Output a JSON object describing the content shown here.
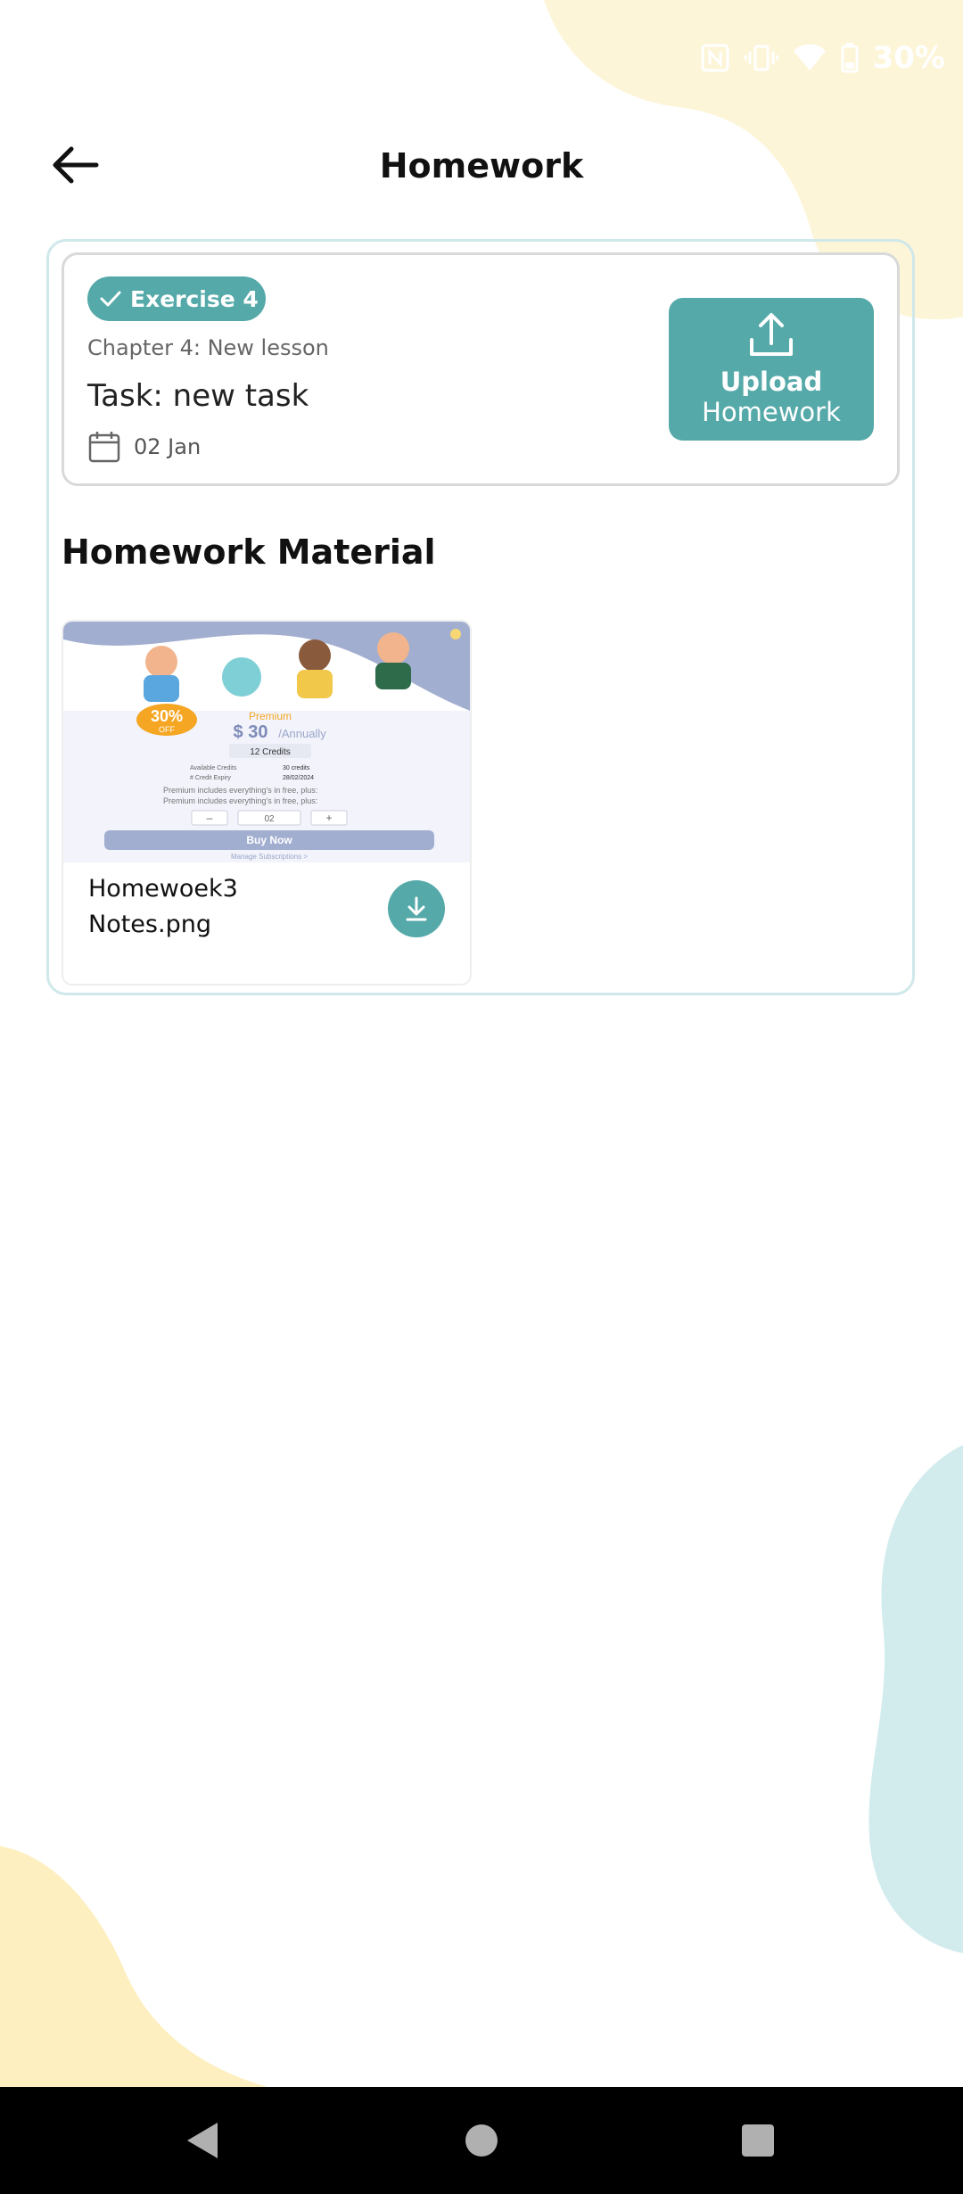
{
  "colors": {
    "accent": "#56a9a9",
    "background": "#ffffff",
    "yellow_blob": "#fdf5d8",
    "teal_blob": "#d2ecee"
  },
  "status_bar": {
    "battery": "30%",
    "icons": [
      "nfc-icon",
      "vibrate-icon",
      "wifi-icon",
      "battery-icon"
    ]
  },
  "header": {
    "title": "Homework",
    "back_icon": "arrow-left-icon"
  },
  "task": {
    "badge": "Exercise 4",
    "chapter": "Chapter 4: New lesson",
    "title": "Task: new task",
    "date": "02 Jan",
    "upload_line1": "Upload",
    "upload_line2": "Homework"
  },
  "section": {
    "title": "Homework Material"
  },
  "materials": [
    {
      "file_name_line1": "Homewoek3",
      "file_name_line2": "Notes.png",
      "preview": {
        "badge": "30%",
        "badge_sub": "OFF",
        "plan": "Premium",
        "price": "$ 30",
        "period": "/Annually",
        "credits": "12 Credits",
        "row1_label": "Available Credits",
        "row1_value": "30 credits",
        "row2_label": "# Credit Expiry",
        "row2_value": "28/02/2024",
        "feature": "Premium includes everything's in free, plus:",
        "qty": "02",
        "buy": "Buy Now",
        "manage": "Manage Subscriptions >"
      }
    }
  ],
  "nav": {
    "back": "nav-back-icon",
    "home": "nav-home-icon",
    "recents": "nav-recents-icon"
  }
}
